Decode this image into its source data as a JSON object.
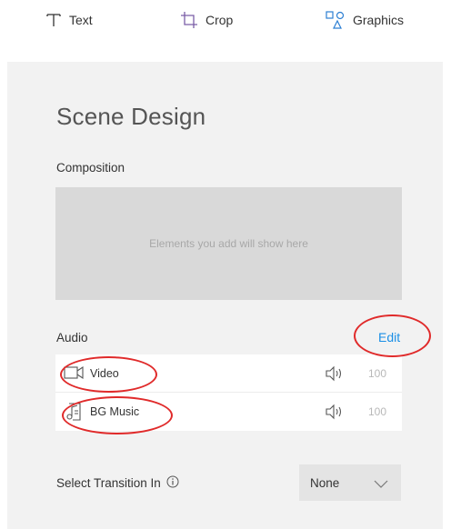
{
  "toolbar": {
    "items": [
      {
        "label": "Text",
        "icon": "text-icon"
      },
      {
        "label": "Crop",
        "icon": "crop-icon"
      },
      {
        "label": "Graphics",
        "icon": "graphics-icon"
      }
    ]
  },
  "scene": {
    "title": "Scene Design",
    "composition": {
      "label": "Composition",
      "placeholder": "Elements you add will show here"
    },
    "audio": {
      "label": "Audio",
      "edit_label": "Edit",
      "tracks": [
        {
          "name": "Video",
          "icon": "video-camera-icon",
          "volume": "100"
        },
        {
          "name": "BG Music",
          "icon": "music-file-icon",
          "volume": "100"
        }
      ]
    },
    "transition": {
      "label": "Select Transition In",
      "selected": "None"
    }
  },
  "colors": {
    "accent": "#1a8fe6",
    "annotation": "#e02a2a",
    "panel_bg": "#f2f2f2"
  }
}
